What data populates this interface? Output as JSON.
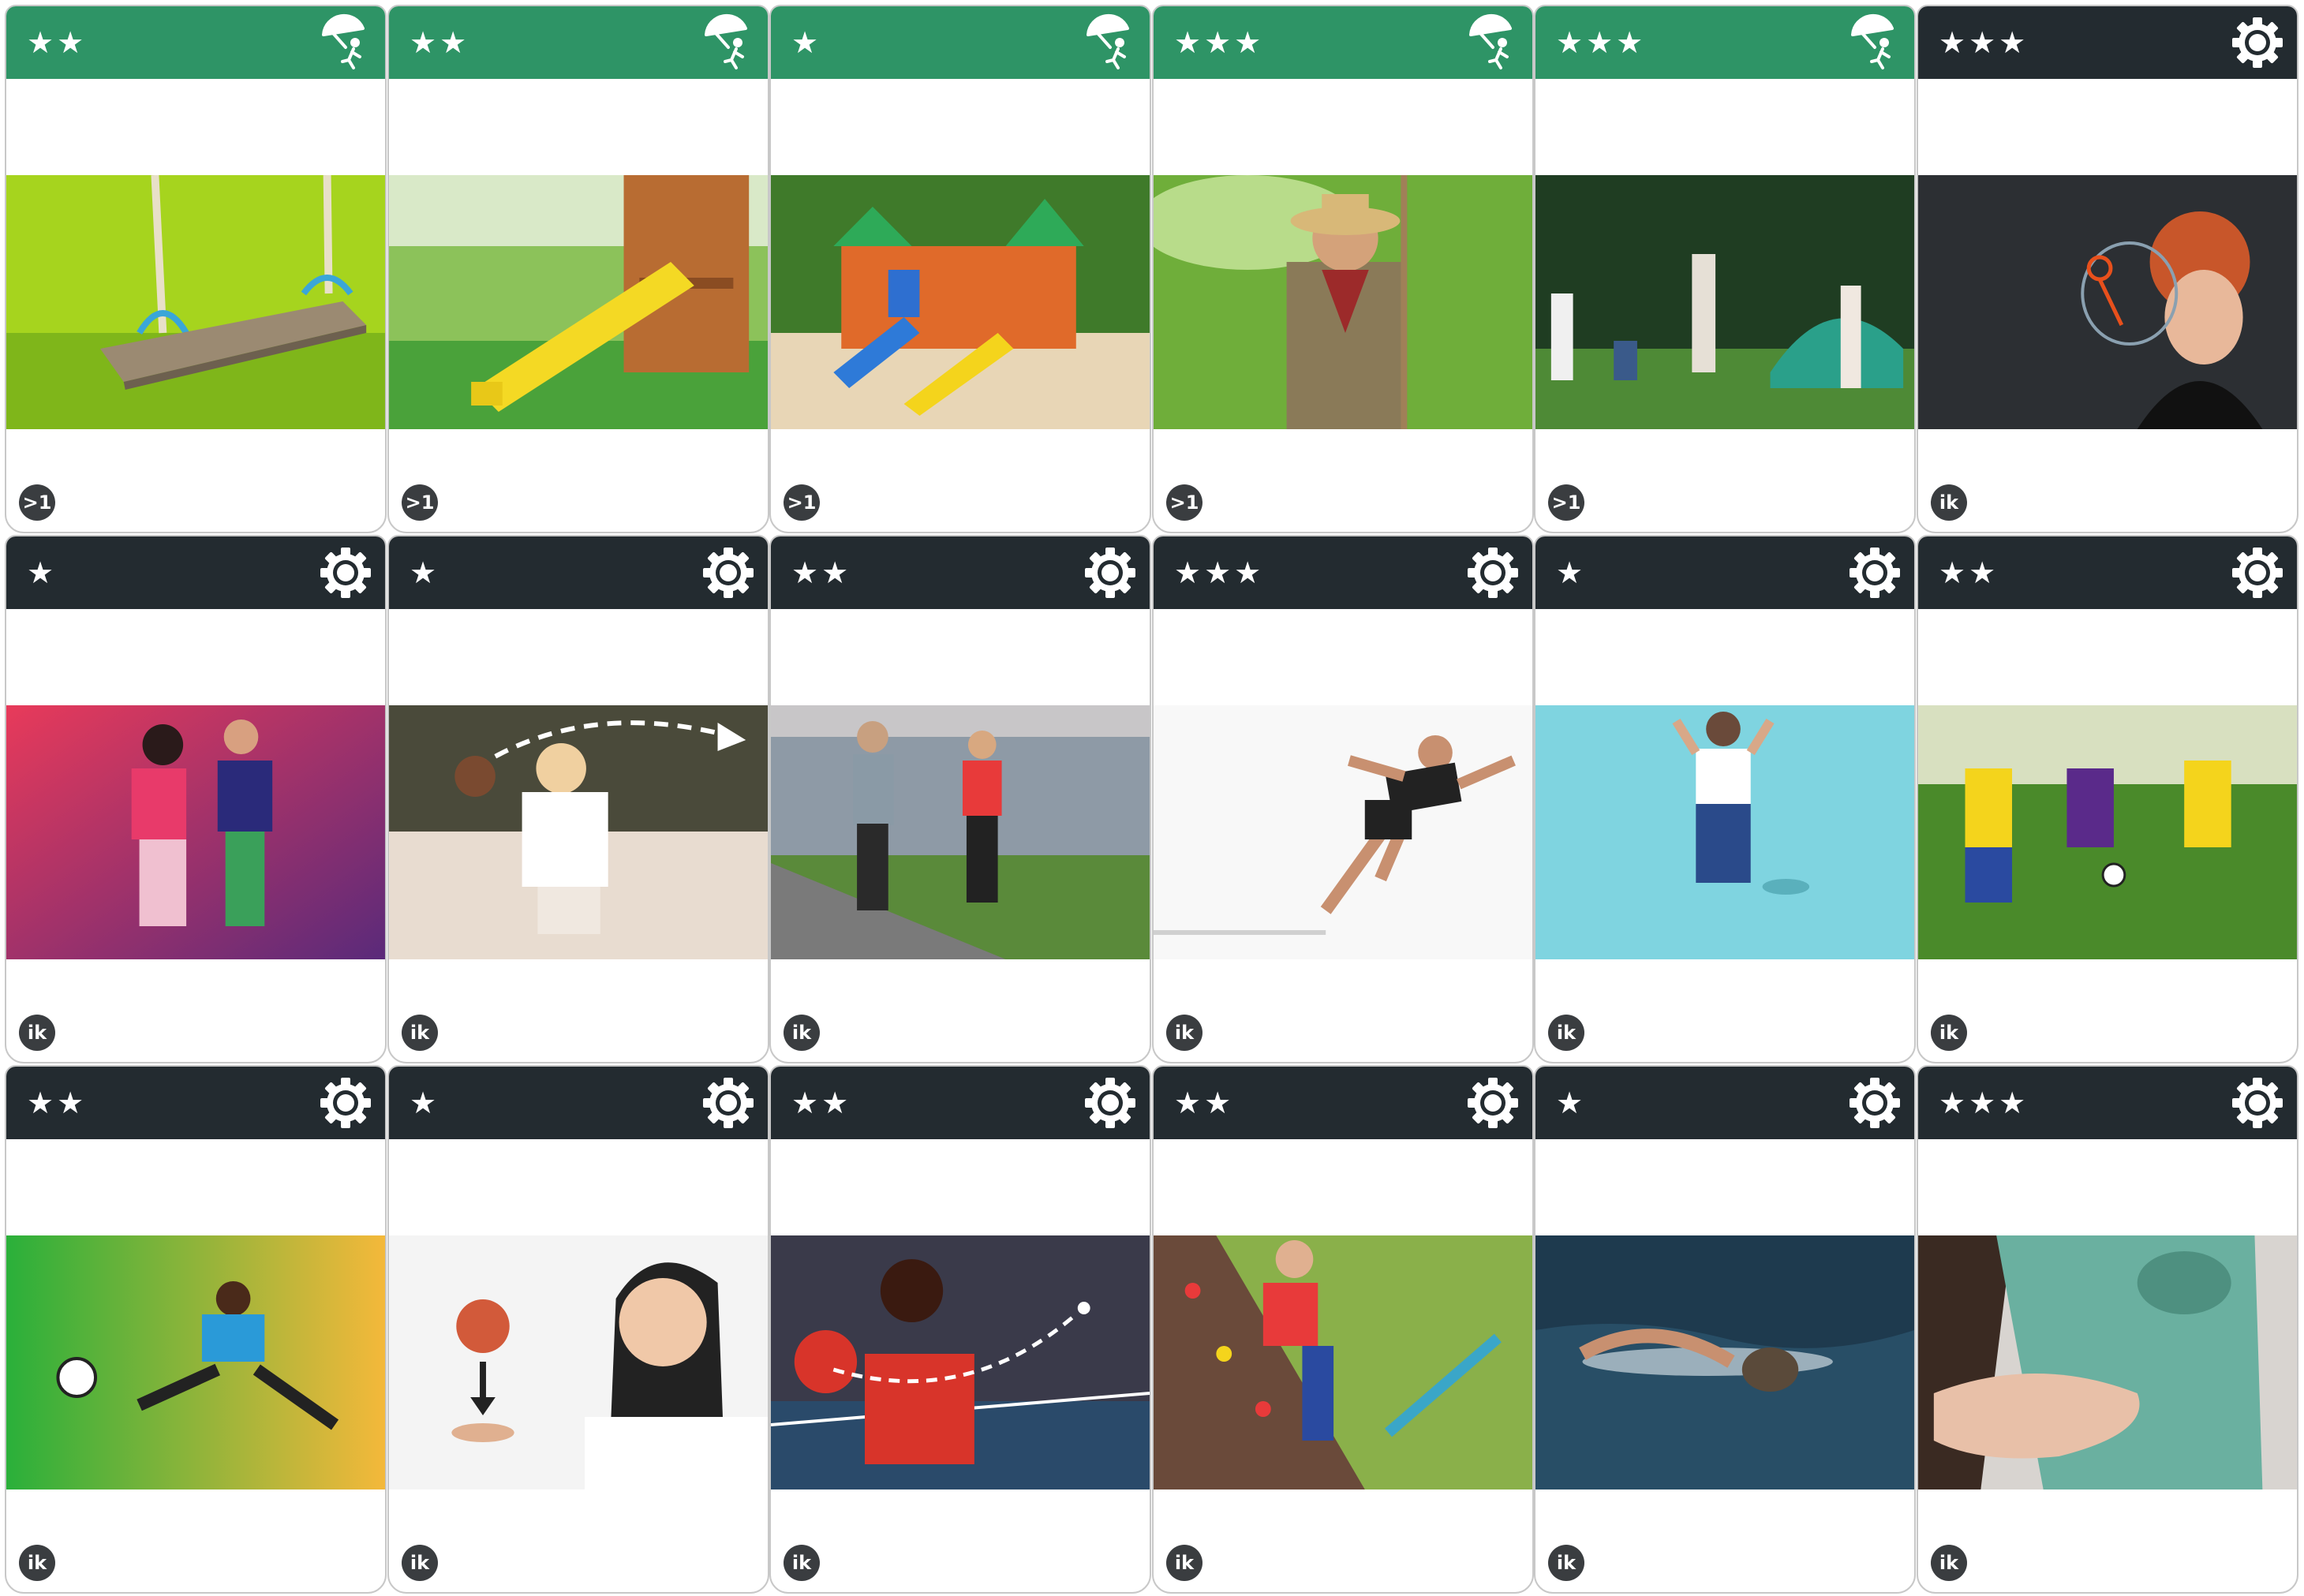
{
  "colors": {
    "outdoor_header": "#2e9466",
    "indoor_header": "#232b30",
    "badge": "#3a3d40"
  },
  "cards": [
    {
      "stars": "★★",
      "header": "green",
      "icon": "umbrella-person-icon",
      "badge": ">1",
      "image": "wooden swing with blue hooks on green grass"
    },
    {
      "stars": "★★",
      "header": "green",
      "icon": "umbrella-person-icon",
      "badge": ">1",
      "image": "yellow slide on wooden play structure"
    },
    {
      "stars": "★",
      "header": "green",
      "icon": "umbrella-person-icon",
      "badge": ">1",
      "image": "colorful playground with slides on sand"
    },
    {
      "stars": "★★★",
      "header": "green",
      "icon": "umbrella-person-icon",
      "badge": ">1",
      "image": "boy scout in uniform in green field"
    },
    {
      "stars": "★★★",
      "header": "green",
      "icon": "umbrella-person-icon",
      "badge": ">1",
      "image": "children camping next to a tent in forest"
    },
    {
      "stars": "★★★",
      "header": "dark",
      "icon": "gear-icon",
      "badge": "ik",
      "image": "red-haired woman blowing soap bubbles"
    },
    {
      "stars": "★",
      "header": "dark",
      "icon": "gear-icon",
      "badge": "ik",
      "image": "two people dancing in neon light"
    },
    {
      "stars": "★",
      "header": "dark",
      "icon": "gear-icon",
      "badge": "ik",
      "image": "woman throwing a ball with dashed arrow"
    },
    {
      "stars": "★★",
      "header": "dark",
      "icon": "gear-icon",
      "badge": "ik",
      "image": "two people jogging along a river"
    },
    {
      "stars": "★★★",
      "header": "dark",
      "icon": "gear-icon",
      "badge": "ik",
      "image": "woman sprinting on white background"
    },
    {
      "stars": "★",
      "header": "dark",
      "icon": "gear-icon",
      "badge": "ik",
      "image": "woman jumping on light blue background"
    },
    {
      "stars": "★★",
      "header": "dark",
      "icon": "gear-icon",
      "badge": "ik",
      "image": "kids playing football on a field"
    },
    {
      "stars": "★★",
      "header": "dark",
      "icon": "gear-icon",
      "badge": "ik",
      "image": "man kicking a football on green-orange background"
    },
    {
      "stars": "★",
      "header": "dark",
      "icon": "gear-icon",
      "badge": "ik",
      "image": "woman catching a falling apple"
    },
    {
      "stars": "★★",
      "header": "dark",
      "icon": "gear-icon",
      "badge": "ik",
      "image": "woman playing table tennis"
    },
    {
      "stars": "★★",
      "header": "dark",
      "icon": "gear-icon",
      "badge": "ik",
      "image": "child climbing a climbing wall"
    },
    {
      "stars": "★",
      "header": "dark",
      "icon": "gear-icon",
      "badge": "ik",
      "image": "person swimming front crawl in water"
    },
    {
      "stars": "★★★",
      "header": "dark",
      "icon": "gear-icon",
      "badge": "ik",
      "image": "sweaty shirt under the arm"
    }
  ]
}
